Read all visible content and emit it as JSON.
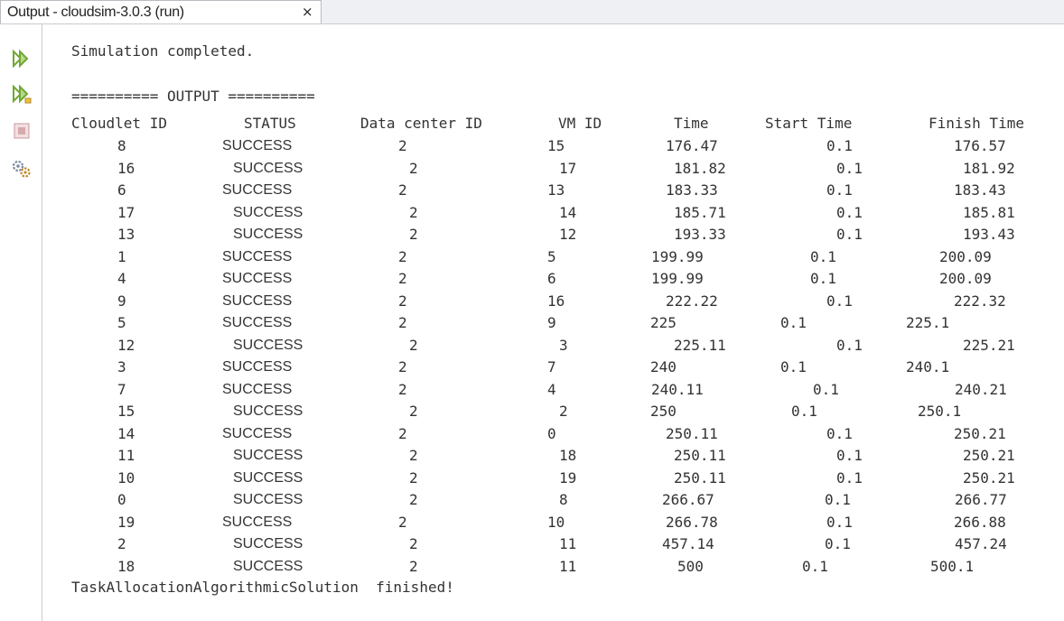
{
  "window": {
    "tab_title": "Output - cloudsim-3.0.3 (run)",
    "close_glyph": "×"
  },
  "toolbar": [
    {
      "icon": "rerun-icon"
    },
    {
      "icon": "rerun-with-options-icon"
    },
    {
      "icon": "stop-icon"
    },
    {
      "icon": "settings-icon"
    }
  ],
  "output": {
    "line1": "Simulation completed.",
    "line2": "",
    "separator": "========== OUTPUT ==========",
    "headers": [
      "Cloudlet ID",
      "STATUS",
      "Data center ID",
      "VM ID",
      "Time",
      "Start Time",
      "Finish Time"
    ],
    "rows": [
      [
        "8",
        "SUCCESS",
        "2",
        "15",
        "176.47",
        "0.1",
        "176.57"
      ],
      [
        "16",
        "SUCCESS",
        "2",
        "17",
        "181.82",
        "0.1",
        "181.92"
      ],
      [
        "6",
        "SUCCESS",
        "2",
        "13",
        "183.33",
        "0.1",
        "183.43"
      ],
      [
        "17",
        "SUCCESS",
        "2",
        "14",
        "185.71",
        "0.1",
        "185.81"
      ],
      [
        "13",
        "SUCCESS",
        "2",
        "12",
        "193.33",
        "0.1",
        "193.43"
      ],
      [
        "1",
        "SUCCESS",
        "2",
        "5",
        "199.99",
        "0.1",
        "200.09"
      ],
      [
        "4",
        "SUCCESS",
        "2",
        "6",
        "199.99",
        "0.1",
        "200.09"
      ],
      [
        "9",
        "SUCCESS",
        "2",
        "16",
        "222.22",
        "0.1",
        "222.32"
      ],
      [
        "5",
        "SUCCESS",
        "2",
        "9",
        "225",
        "0.1",
        "225.1"
      ],
      [
        "12",
        "SUCCESS",
        "2",
        "3",
        "225.11",
        "0.1",
        "225.21"
      ],
      [
        "3",
        "SUCCESS",
        "2",
        "7",
        "240",
        "0.1",
        "240.1"
      ],
      [
        "7",
        "SUCCESS",
        "2",
        "4",
        "240.11",
        "0.1",
        "240.21"
      ],
      [
        "15",
        "SUCCESS",
        "2",
        "2",
        "250",
        "0.1",
        "250.1"
      ],
      [
        "14",
        "SUCCESS",
        "2",
        "0",
        "250.11",
        "0.1",
        "250.21"
      ],
      [
        "11",
        "SUCCESS",
        "2",
        "18",
        "250.11",
        "0.1",
        "250.21"
      ],
      [
        "10",
        "SUCCESS",
        "2",
        "19",
        "250.11",
        "0.1",
        "250.21"
      ],
      [
        "0",
        "SUCCESS",
        "2",
        "8",
        "266.67",
        "0.1",
        "266.77"
      ],
      [
        "19",
        "SUCCESS",
        "2",
        "10",
        "266.78",
        "0.1",
        "266.88"
      ],
      [
        "2",
        "SUCCESS",
        "2",
        "11",
        "457.14",
        "0.1",
        "457.24"
      ],
      [
        "18",
        "SUCCESS",
        "2",
        "11",
        "500",
        "0.1",
        "500.1"
      ]
    ],
    "footer": "TaskAllocationAlgorithmicSolution  finished!"
  },
  "colors": {
    "run_icon": "#6fa832",
    "stop_icon": "#d6a9ad",
    "settings_icon": "#7a8aa0"
  }
}
